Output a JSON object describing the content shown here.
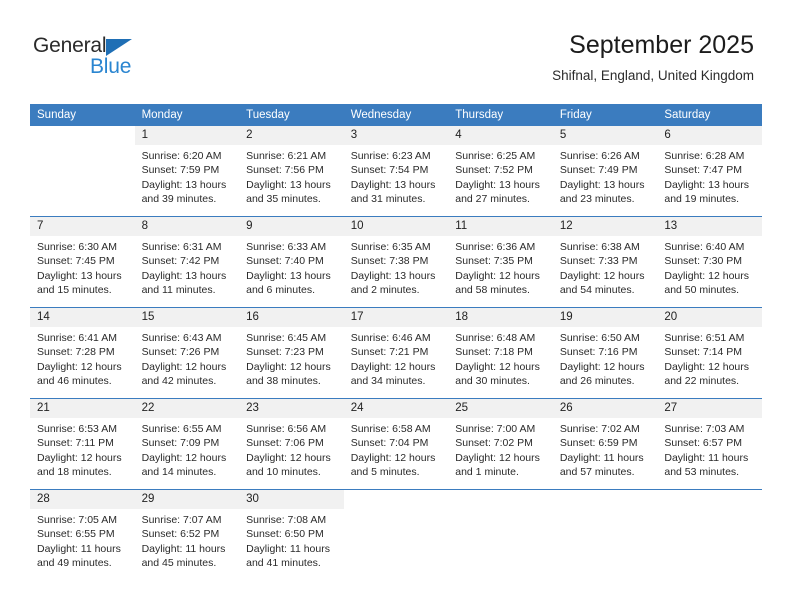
{
  "brand": {
    "name_part1": "General",
    "name_part2": "Blue"
  },
  "header": {
    "title": "September 2025",
    "subtitle": "Shifnal, England, United Kingdom"
  },
  "colors": {
    "header_blue": "#3b7cbf",
    "logo_blue": "#2a85d0",
    "daynum_bg": "#f1f1f1"
  },
  "weekdays": [
    "Sunday",
    "Monday",
    "Tuesday",
    "Wednesday",
    "Thursday",
    "Friday",
    "Saturday"
  ],
  "labels": {
    "sunrise_prefix": "Sunrise:",
    "sunset_prefix": "Sunset:",
    "daylight_prefix": "Daylight:"
  },
  "weeks": [
    [
      {
        "day": "",
        "sunrise": "",
        "sunset": "",
        "daylight": "",
        "blank": true
      },
      {
        "day": "1",
        "sunrise": "Sunrise: 6:20 AM",
        "sunset": "Sunset: 7:59 PM",
        "daylight": "Daylight: 13 hours and 39 minutes."
      },
      {
        "day": "2",
        "sunrise": "Sunrise: 6:21 AM",
        "sunset": "Sunset: 7:56 PM",
        "daylight": "Daylight: 13 hours and 35 minutes."
      },
      {
        "day": "3",
        "sunrise": "Sunrise: 6:23 AM",
        "sunset": "Sunset: 7:54 PM",
        "daylight": "Daylight: 13 hours and 31 minutes."
      },
      {
        "day": "4",
        "sunrise": "Sunrise: 6:25 AM",
        "sunset": "Sunset: 7:52 PM",
        "daylight": "Daylight: 13 hours and 27 minutes."
      },
      {
        "day": "5",
        "sunrise": "Sunrise: 6:26 AM",
        "sunset": "Sunset: 7:49 PM",
        "daylight": "Daylight: 13 hours and 23 minutes."
      },
      {
        "day": "6",
        "sunrise": "Sunrise: 6:28 AM",
        "sunset": "Sunset: 7:47 PM",
        "daylight": "Daylight: 13 hours and 19 minutes."
      }
    ],
    [
      {
        "day": "7",
        "sunrise": "Sunrise: 6:30 AM",
        "sunset": "Sunset: 7:45 PM",
        "daylight": "Daylight: 13 hours and 15 minutes."
      },
      {
        "day": "8",
        "sunrise": "Sunrise: 6:31 AM",
        "sunset": "Sunset: 7:42 PM",
        "daylight": "Daylight: 13 hours and 11 minutes."
      },
      {
        "day": "9",
        "sunrise": "Sunrise: 6:33 AM",
        "sunset": "Sunset: 7:40 PM",
        "daylight": "Daylight: 13 hours and 6 minutes."
      },
      {
        "day": "10",
        "sunrise": "Sunrise: 6:35 AM",
        "sunset": "Sunset: 7:38 PM",
        "daylight": "Daylight: 13 hours and 2 minutes."
      },
      {
        "day": "11",
        "sunrise": "Sunrise: 6:36 AM",
        "sunset": "Sunset: 7:35 PM",
        "daylight": "Daylight: 12 hours and 58 minutes."
      },
      {
        "day": "12",
        "sunrise": "Sunrise: 6:38 AM",
        "sunset": "Sunset: 7:33 PM",
        "daylight": "Daylight: 12 hours and 54 minutes."
      },
      {
        "day": "13",
        "sunrise": "Sunrise: 6:40 AM",
        "sunset": "Sunset: 7:30 PM",
        "daylight": "Daylight: 12 hours and 50 minutes."
      }
    ],
    [
      {
        "day": "14",
        "sunrise": "Sunrise: 6:41 AM",
        "sunset": "Sunset: 7:28 PM",
        "daylight": "Daylight: 12 hours and 46 minutes."
      },
      {
        "day": "15",
        "sunrise": "Sunrise: 6:43 AM",
        "sunset": "Sunset: 7:26 PM",
        "daylight": "Daylight: 12 hours and 42 minutes."
      },
      {
        "day": "16",
        "sunrise": "Sunrise: 6:45 AM",
        "sunset": "Sunset: 7:23 PM",
        "daylight": "Daylight: 12 hours and 38 minutes."
      },
      {
        "day": "17",
        "sunrise": "Sunrise: 6:46 AM",
        "sunset": "Sunset: 7:21 PM",
        "daylight": "Daylight: 12 hours and 34 minutes."
      },
      {
        "day": "18",
        "sunrise": "Sunrise: 6:48 AM",
        "sunset": "Sunset: 7:18 PM",
        "daylight": "Daylight: 12 hours and 30 minutes."
      },
      {
        "day": "19",
        "sunrise": "Sunrise: 6:50 AM",
        "sunset": "Sunset: 7:16 PM",
        "daylight": "Daylight: 12 hours and 26 minutes."
      },
      {
        "day": "20",
        "sunrise": "Sunrise: 6:51 AM",
        "sunset": "Sunset: 7:14 PM",
        "daylight": "Daylight: 12 hours and 22 minutes."
      }
    ],
    [
      {
        "day": "21",
        "sunrise": "Sunrise: 6:53 AM",
        "sunset": "Sunset: 7:11 PM",
        "daylight": "Daylight: 12 hours and 18 minutes."
      },
      {
        "day": "22",
        "sunrise": "Sunrise: 6:55 AM",
        "sunset": "Sunset: 7:09 PM",
        "daylight": "Daylight: 12 hours and 14 minutes."
      },
      {
        "day": "23",
        "sunrise": "Sunrise: 6:56 AM",
        "sunset": "Sunset: 7:06 PM",
        "daylight": "Daylight: 12 hours and 10 minutes."
      },
      {
        "day": "24",
        "sunrise": "Sunrise: 6:58 AM",
        "sunset": "Sunset: 7:04 PM",
        "daylight": "Daylight: 12 hours and 5 minutes."
      },
      {
        "day": "25",
        "sunrise": "Sunrise: 7:00 AM",
        "sunset": "Sunset: 7:02 PM",
        "daylight": "Daylight: 12 hours and 1 minute."
      },
      {
        "day": "26",
        "sunrise": "Sunrise: 7:02 AM",
        "sunset": "Sunset: 6:59 PM",
        "daylight": "Daylight: 11 hours and 57 minutes."
      },
      {
        "day": "27",
        "sunrise": "Sunrise: 7:03 AM",
        "sunset": "Sunset: 6:57 PM",
        "daylight": "Daylight: 11 hours and 53 minutes."
      }
    ],
    [
      {
        "day": "28",
        "sunrise": "Sunrise: 7:05 AM",
        "sunset": "Sunset: 6:55 PM",
        "daylight": "Daylight: 11 hours and 49 minutes."
      },
      {
        "day": "29",
        "sunrise": "Sunrise: 7:07 AM",
        "sunset": "Sunset: 6:52 PM",
        "daylight": "Daylight: 11 hours and 45 minutes."
      },
      {
        "day": "30",
        "sunrise": "Sunrise: 7:08 AM",
        "sunset": "Sunset: 6:50 PM",
        "daylight": "Daylight: 11 hours and 41 minutes."
      },
      {
        "day": "",
        "sunrise": "",
        "sunset": "",
        "daylight": "",
        "blank": true
      },
      {
        "day": "",
        "sunrise": "",
        "sunset": "",
        "daylight": "",
        "blank": true
      },
      {
        "day": "",
        "sunrise": "",
        "sunset": "",
        "daylight": "",
        "blank": true
      },
      {
        "day": "",
        "sunrise": "",
        "sunset": "",
        "daylight": "",
        "blank": true
      }
    ]
  ]
}
